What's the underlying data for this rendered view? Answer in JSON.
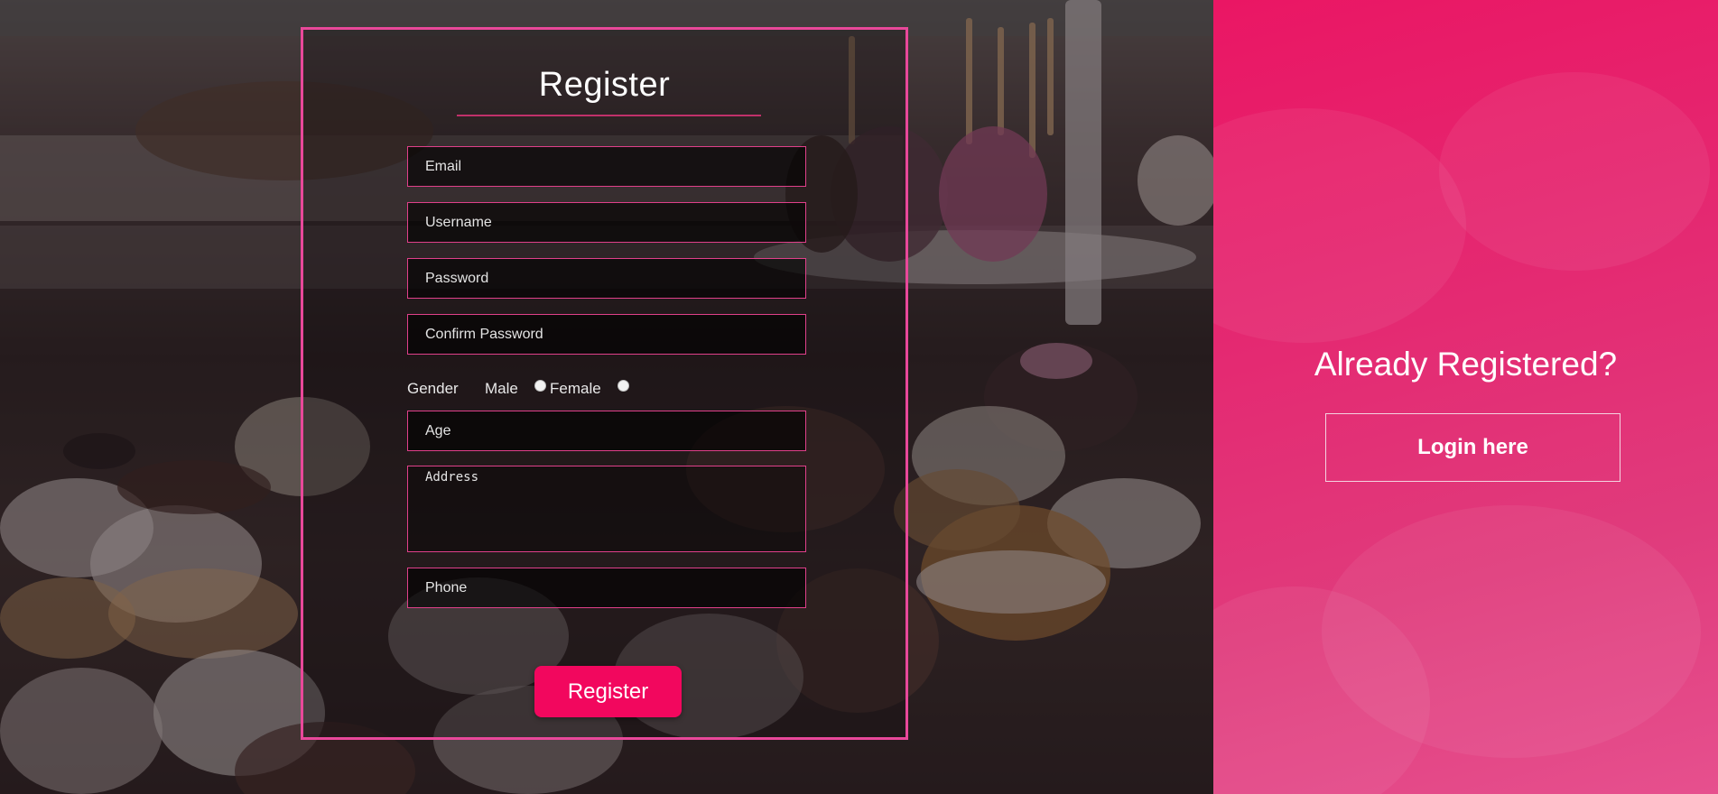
{
  "form": {
    "title": "Register",
    "fields": {
      "email_placeholder": "Email",
      "username_placeholder": "Username",
      "password_placeholder": "Password",
      "confirm_password_placeholder": "Confirm Password",
      "age_placeholder": "Age",
      "address_placeholder": "Address",
      "phone_placeholder": "Phone"
    },
    "gender": {
      "label": "Gender",
      "options": [
        "Male",
        "Female"
      ]
    },
    "submit_label": "Register"
  },
  "side_panel": {
    "title": "Already Registered?",
    "login_label": "Login here"
  },
  "colors": {
    "accent": "#f2075e",
    "border": "#e8489a",
    "panel": "#e42a72"
  }
}
